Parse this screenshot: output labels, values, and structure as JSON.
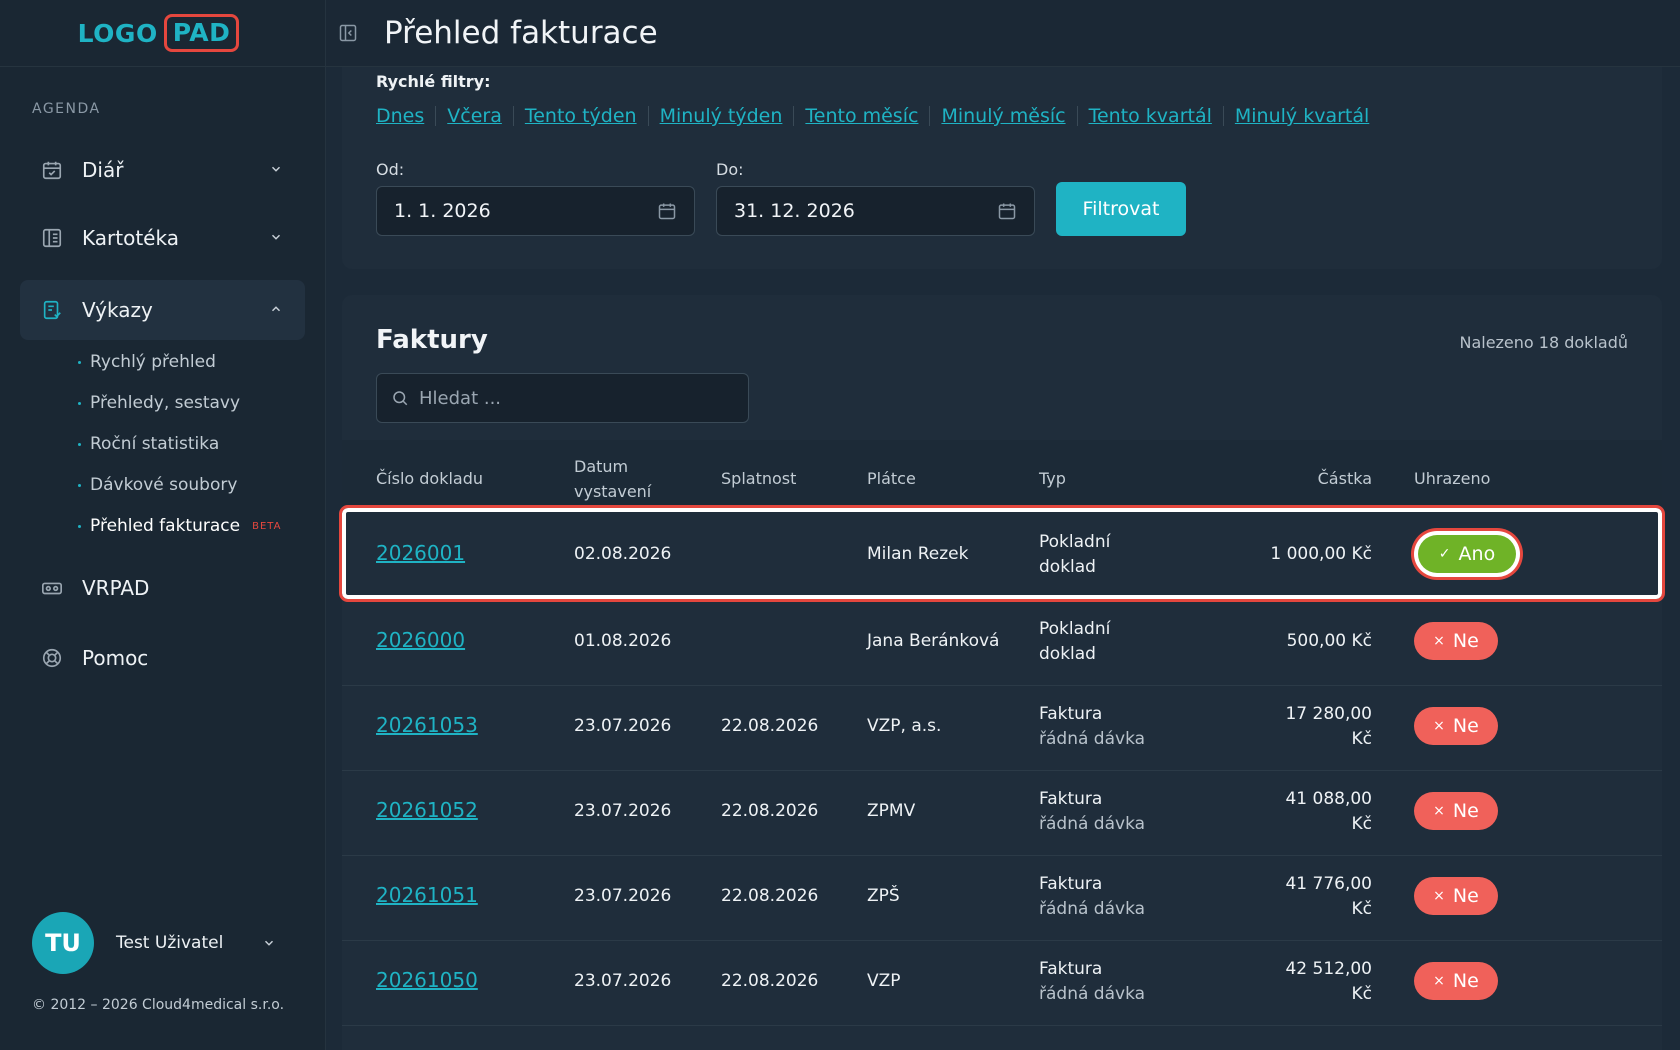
{
  "logo": {
    "part1": "LOGO",
    "part2": "PAD"
  },
  "header": {
    "title": "Přehled fakturace"
  },
  "sidebar": {
    "section": "AGENDA",
    "items": [
      {
        "label": "Diář",
        "icon": "calendar-icon"
      },
      {
        "label": "Kartotéka",
        "icon": "folder-icon"
      },
      {
        "label": "Výkazy",
        "icon": "report-icon"
      },
      {
        "label": "VRPAD",
        "icon": "vr-icon"
      },
      {
        "label": "Pomoc",
        "icon": "lifebuoy-icon"
      }
    ],
    "subitems": [
      {
        "label": "Rychlý přehled"
      },
      {
        "label": "Přehledy, sestavy"
      },
      {
        "label": "Roční statistika"
      },
      {
        "label": "Dávkové soubory"
      },
      {
        "label": "Přehled fakturace",
        "badge": "BETA"
      }
    ],
    "user": {
      "initials": "TU",
      "name": "Test Uživatel"
    },
    "copyright": "© 2012 – 2026 Cloud4medical s.r.o."
  },
  "filters": {
    "quick_label": "Rychlé filtry:",
    "quick": [
      "Dnes",
      "Včera",
      "Tento týden",
      "Minulý týden",
      "Tento měsíc",
      "Minulý měsíc",
      "Tento kvartál",
      "Minulý kvartál"
    ],
    "from_label": "Od:",
    "from_value": "1. 1. 2026",
    "to_label": "Do:",
    "to_value": "31. 12. 2026",
    "button": "Filtrovat"
  },
  "invoices": {
    "title": "Faktury",
    "count": "Nalezeno 18 dokladů",
    "search_placeholder": "Hledat ...",
    "columns": {
      "number": "Číslo dokladu",
      "issued_1": "Datum",
      "issued_2": "vystavení",
      "due": "Splatnost",
      "payer": "Plátce",
      "type": "Typ",
      "amount": "Částka",
      "paid": "Uhrazeno"
    },
    "rows": [
      {
        "number": "2026001",
        "issued": "02.08.2026",
        "due": "",
        "payer": "Milan Rezek",
        "type1": "Pokladní",
        "type2": "doklad",
        "amount1": "1 000,00 Kč",
        "amount2": "",
        "paid": "Ano"
      },
      {
        "number": "2026000",
        "issued": "01.08.2026",
        "due": "",
        "payer": "Jana Beránková",
        "type1": "Pokladní",
        "type2": "doklad",
        "amount1": "500,00 Kč",
        "amount2": "",
        "paid": "Ne"
      },
      {
        "number": "20261053",
        "issued": "23.07.2026",
        "due": "22.08.2026",
        "payer": "VZP, a.s.",
        "type1": "Faktura",
        "type2": "řádná dávka",
        "amount1": "17 280,00",
        "amount2": "Kč",
        "paid": "Ne"
      },
      {
        "number": "20261052",
        "issued": "23.07.2026",
        "due": "22.08.2026",
        "payer": "ZPMV",
        "type1": "Faktura",
        "type2": "řádná dávka",
        "amount1": "41 088,00",
        "amount2": "Kč",
        "paid": "Ne"
      },
      {
        "number": "20261051",
        "issued": "23.07.2026",
        "due": "22.08.2026",
        "payer": "ZPŠ",
        "type1": "Faktura",
        "type2": "řádná dávka",
        "amount1": "41 776,00",
        "amount2": "Kč",
        "paid": "Ne"
      },
      {
        "number": "20261050",
        "issued": "23.07.2026",
        "due": "22.08.2026",
        "payer": "VZP",
        "type1": "Faktura",
        "type2": "řádná dávka",
        "amount1": "42 512,00",
        "amount2": "Kč",
        "paid": "Ne"
      }
    ]
  },
  "colors": {
    "accent": "#1fb3c4",
    "paid": "#6fb327",
    "unpaid": "#f0615a",
    "highlight": "#e5473e"
  }
}
